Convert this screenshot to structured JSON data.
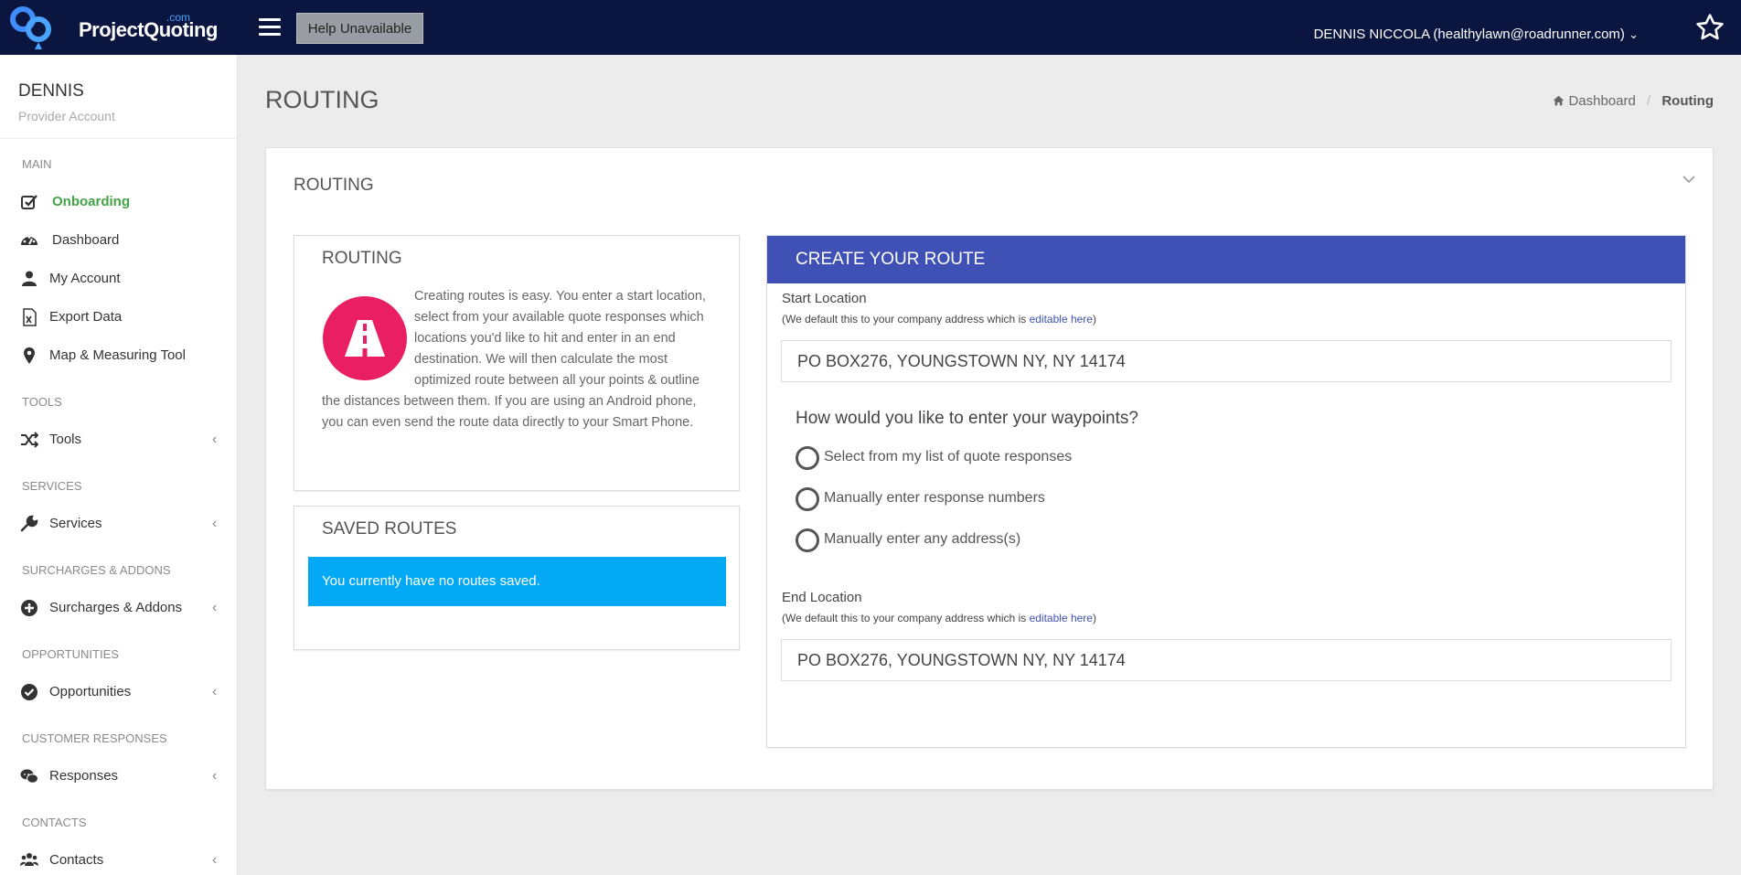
{
  "brand": {
    "name": "ProjectQuoting",
    "suffix": ".com"
  },
  "topbar": {
    "help_label": "Help Unavailable",
    "user_label": "DENNIS NICCOLA (healthylawn@roadrunner.com)",
    "chevron": "⌄"
  },
  "sidebar": {
    "profile_name": "DENNIS",
    "profile_sub": "Provider Account",
    "sections": {
      "main": "MAIN",
      "tools": "TOOLS",
      "services": "SERVICES",
      "surcharges": "SURCHARGES & ADDONS",
      "opportunities": "OPPORTUNITIES",
      "responses": "CUSTOMER RESPONSES",
      "contacts": "CONTACTS"
    },
    "items": {
      "onboarding": "Onboarding",
      "dashboard": "Dashboard",
      "my_account": "My Account",
      "export_data": "Export Data",
      "map_tool": "Map & Measuring Tool",
      "tools": "Tools",
      "services": "Services",
      "surcharges": "Surcharges & Addons",
      "opportunities": "Opportunities",
      "responses": "Responses",
      "contacts": "Contacts"
    },
    "chevron": "‹",
    "accent": "#43a347"
  },
  "page": {
    "title": "ROUTING",
    "breadcrumb_home": "Dashboard",
    "breadcrumb_current": "Routing",
    "breadcrumb_sep": "/"
  },
  "card": {
    "title": "ROUTING"
  },
  "routing_panel": {
    "title": "ROUTING",
    "description": "Creating routes is easy. You enter a start location, select from your available quote responses which locations you'd like to hit and enter in an end destination. We will then calculate the most optimized route between all your points & outline the distances between them. If you are using an Android phone, you can even send the route data directly to your Smart Phone."
  },
  "saved_routes": {
    "title": "SAVED ROUTES",
    "empty_message": "You currently have no routes saved."
  },
  "create_route": {
    "title": "CREATE YOUR ROUTE",
    "start_label": "Start Location",
    "help_prefix": "(We default this to your company address which is ",
    "help_link": "editable here",
    "help_suffix": ")",
    "start_value": "PO BOX276, YOUNGSTOWN NY, NY 14174",
    "waypoint_question": "How would you like to enter your waypoints?",
    "waypoint_options": [
      "Select from my list of quote responses",
      "Manually enter response numbers",
      "Manually enter any address(s)"
    ],
    "end_label": "End Location",
    "end_value": "PO BOX276, YOUNGSTOWN NY, NY 14174",
    "header_color": "#3f51b5"
  },
  "colors": {
    "topbar": "#0a1540",
    "alert": "#03a9f4",
    "routing_icon": "#e91e63"
  }
}
